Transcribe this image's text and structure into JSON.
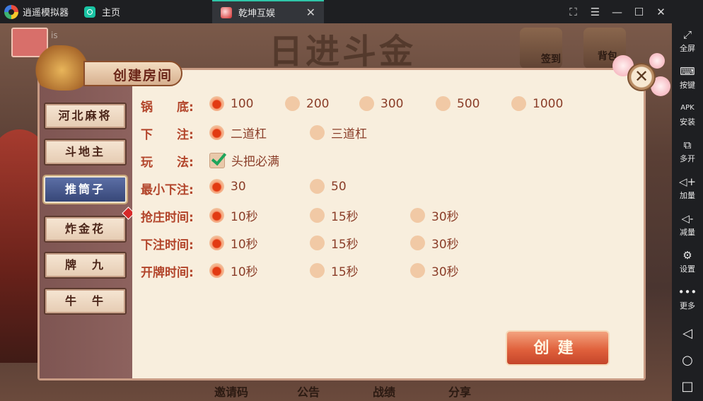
{
  "emulator": {
    "app_name": "逍遥模拟器",
    "home_tab": "主页",
    "game_tab": "乾坤互娱",
    "sidebar": [
      {
        "icon": "fullscreen-icon",
        "label": "全屏"
      },
      {
        "icon": "keyboard-icon",
        "label": "按键"
      },
      {
        "icon": "apk-install-icon",
        "label": "安装"
      },
      {
        "icon": "multi-instance-icon",
        "label": "多开"
      },
      {
        "icon": "volume-up-icon",
        "label": "加量"
      },
      {
        "icon": "volume-down-icon",
        "label": "减量"
      },
      {
        "icon": "settings-gear-icon",
        "label": "设置"
      },
      {
        "icon": "more-dots-icon",
        "label": "更多"
      }
    ]
  },
  "game": {
    "banner": "日进斗金",
    "nickname": "is",
    "top_buttons": [
      "签到",
      "背包"
    ],
    "bottom_buttons": [
      "邀请码",
      "公告",
      "战绩",
      "分享"
    ]
  },
  "dialog": {
    "title": "创建房间",
    "game_tabs": [
      "河北麻将",
      "斗地主",
      "推筒子",
      "炸金花",
      "牌　九",
      "牛　牛"
    ],
    "active_tab_index": 2,
    "rows": [
      {
        "label": "锅　　底:",
        "type": "radio",
        "options": [
          "100",
          "200",
          "300",
          "500",
          "1000"
        ],
        "selected": 0
      },
      {
        "label": "下　　注:",
        "type": "radio",
        "options": [
          "二道杠",
          "三道杠"
        ],
        "selected": 0
      },
      {
        "label": "玩　　法:",
        "type": "checkbox",
        "options": [
          "头把必满"
        ],
        "checked": true
      },
      {
        "label": "最小下注:",
        "type": "radio",
        "options": [
          "30",
          "50"
        ],
        "selected": 0
      },
      {
        "label": "抢庄时间:",
        "type": "radio",
        "options": [
          "10秒",
          "15秒",
          "30秒"
        ],
        "selected": 0
      },
      {
        "label": "下注时间:",
        "type": "radio",
        "options": [
          "10秒",
          "15秒",
          "30秒"
        ],
        "selected": 0
      },
      {
        "label": "开牌时间:",
        "type": "radio",
        "options": [
          "10秒",
          "15秒",
          "30秒"
        ],
        "selected": 0
      }
    ],
    "create_button": "创建"
  }
}
